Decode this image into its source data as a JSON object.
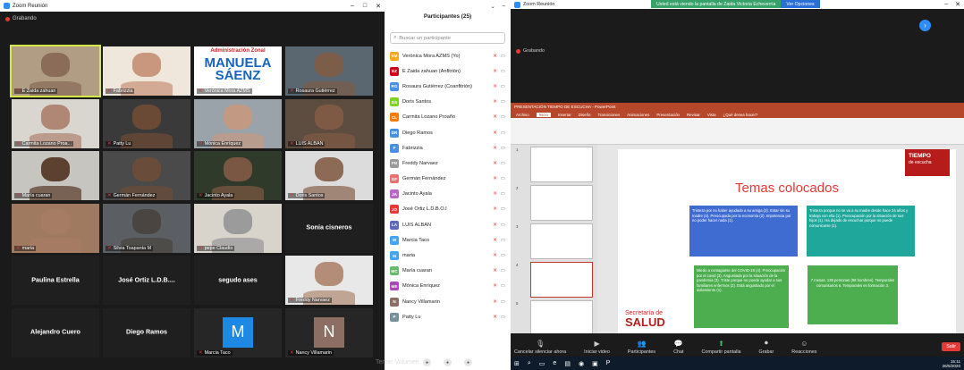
{
  "left_window": {
    "title": "Zoom Reunión",
    "recording": "Grabando"
  },
  "tiles": [
    {
      "name": "E Zaida zahuan",
      "face": "#8a6c58",
      "bg": "#b19c84",
      "active": true
    },
    {
      "name": "Fabrizzia",
      "face": "#c9977d",
      "bg": "#efe6dc"
    },
    {
      "name": "Verónica Mora AZMS",
      "poster": true,
      "poster_head": "Administración Zonal",
      "poster_big": "MANUELA SÁENZ"
    },
    {
      "name": "Rosaura Gutiérrez",
      "face": "#7b5d4a",
      "bg": "#5a6670"
    },
    {
      "name": "Carmita Lozano Proa...",
      "face": "#b08775",
      "bg": "#d9d6cf"
    },
    {
      "name": "Patty Lu",
      "face": "#6b4a35",
      "bg": "#3a3a3a"
    },
    {
      "name": "Mónica Enríquez",
      "face": "#c29a83",
      "bg": "#9aa3aa"
    },
    {
      "name": "LUIS ALBAN",
      "face": "#7e5a44",
      "bg": "#5d4c40"
    },
    {
      "name": "María cuaran",
      "face": "#5c4030",
      "bg": "#c7c5c0"
    },
    {
      "name": "Germán Fernández",
      "face": "#6a4c3a",
      "bg": "#4a4a4a"
    },
    {
      "name": "Jacinto Ayala",
      "face": "#7a5742",
      "bg": "#2f3a2b"
    },
    {
      "name": "Doris Santos",
      "face": "#8c6a55",
      "bg": "#dcdcdc"
    },
    {
      "name": "maria",
      "face": "#a77c65",
      "bg": "#a07a60"
    },
    {
      "name": "Silvia Toapanta M",
      "face": "#4a4540",
      "bg": "#5b5f63"
    },
    {
      "name": "pepe Claudio",
      "face": "#9b9b9b",
      "bg": "#d8d4cc"
    },
    {
      "name": "Sonia cisneros",
      "text_only": true
    },
    {
      "name": "Paulina Estrella",
      "text_only": true
    },
    {
      "name": "José Ortiz L.D.B....",
      "text_only": true
    },
    {
      "name": "segudo ases",
      "text_only": true
    },
    {
      "name": "Freddy Narvaez",
      "face": "#b38d78",
      "bg": "#e8e8e8"
    },
    {
      "name": "Alejandro Cuero",
      "text_only": true
    },
    {
      "name": "Diego Ramos",
      "text_only": true
    },
    {
      "name": "Marcia Taco",
      "avatar": "M",
      "avatar_color": "#1e88e5"
    },
    {
      "name": "Nancy Villamarin",
      "avatar": "N",
      "avatar_color": "#8d6e63"
    }
  ],
  "participants_panel": {
    "title": "Participantes (25)",
    "search_placeholder": "Buscar un participante",
    "items": [
      {
        "initials": "VM",
        "color": "#f5a623",
        "name": "Verónica Mora AZMS (Yo)"
      },
      {
        "initials": "EZ",
        "color": "#d0021b",
        "name": "E Zaida zahuan (Anfitrión)"
      },
      {
        "initials": "RG",
        "color": "#4a90e2",
        "name": "Rosaura Gutiérrez (Coanfitrión)"
      },
      {
        "initials": "DS",
        "color": "#7ed321",
        "name": "Doris Santos"
      },
      {
        "initials": "CL",
        "color": "#f57c00",
        "name": "Carmita Lozano Proaño"
      },
      {
        "initials": "DR",
        "color": "#4a90e2",
        "name": "Diego Ramos"
      },
      {
        "initials": "F",
        "color": "#4a90e2",
        "name": "Fabrizzia"
      },
      {
        "initials": "FN",
        "color": "#9b9b9b",
        "name": "Freddy Narvaez"
      },
      {
        "initials": "GF",
        "color": "#e57373",
        "name": "Germán Fernández"
      },
      {
        "initials": "JA",
        "color": "#ba68c8",
        "name": "Jacinto Ayala"
      },
      {
        "initials": "JO",
        "color": "#e53935",
        "name": "José Ortiz L.D.B.O.I"
      },
      {
        "initials": "LA",
        "color": "#5c6bc0",
        "name": "LUIS ALBAN"
      },
      {
        "initials": "M",
        "color": "#42a5f5",
        "name": "Marcia Taco"
      },
      {
        "initials": "M",
        "color": "#42a5f5",
        "name": "maria"
      },
      {
        "initials": "MC",
        "color": "#66bb6a",
        "name": "María cuaran"
      },
      {
        "initials": "ME",
        "color": "#ab47bc",
        "name": "Mónica Enríquez"
      },
      {
        "initials": "N",
        "color": "#8d6e63",
        "name": "Nancy Villamarin"
      },
      {
        "initials": "P",
        "color": "#78909c",
        "name": "Patty Lu"
      }
    ]
  },
  "watermark": "Tercer Volumen",
  "right_window": {
    "title": "Zoom Reunión",
    "share_banner": "Usted está viendo la pantalla de Zaida Victoria Echeverría",
    "share_options": "Ver Opciones",
    "recording": "Grabando",
    "ppt_title": "PRESENTACIÓN TIEMPO DE ESCUCHA - PowerPoint",
    "ppt_tabs": [
      "Archivo",
      "Inicio",
      "Insertar",
      "Diseño",
      "Transiciones",
      "Animaciones",
      "Presentación",
      "Revisar",
      "Vista",
      "¿Qué desea hacer?"
    ],
    "slide_title": "Temas colocados",
    "logo_line1": "TIEMPO",
    "logo_line2": "de escucha",
    "box1": "Tristeza por no haber ayudado a su amiga (2). Estar sin su madre (4). Preocupada por la economía (2). Impotencia por no poder hacer nada (1).",
    "box2": "Tristeza porque no se va a su madre desde hace 24 años y trabaja con ella (1). Preocupación por la situación de sus hijos (1). Ha dejado de escuchar porque no puede comunicarse (1).",
    "box3": "Miedo a contagiarse del COVID-19 (4). Preocupación por el covid (3). Angustiada por la situación de la pandemia (3). Triste porque no puede ayudar a sus familiares enfermos (2). Está angustiado por el aislamiento (1).",
    "box4": "7 mesas. 139 personas (98 hombres). Temporales comunitarios 6. Temporales en formación 3.",
    "secretaria_line1": "Secretaría de",
    "secretaria_line2": "SALUD"
  },
  "toolbar": {
    "items": [
      {
        "label": "Cancelar silenciar ahora",
        "icon": "mic-icon"
      },
      {
        "label": "Iniciar video",
        "icon": "video-icon"
      },
      {
        "label": "Participantes",
        "icon": "participants-icon"
      },
      {
        "label": "Chat",
        "icon": "chat-icon"
      },
      {
        "label": "Compartir pantalla",
        "icon": "share-icon"
      },
      {
        "label": "Grabar",
        "icon": "record-icon"
      },
      {
        "label": "Reacciones",
        "icon": "reactions-icon"
      }
    ],
    "end_label": "Salir"
  },
  "taskbar": {
    "time": "15:11",
    "date": "26/5/2020"
  }
}
